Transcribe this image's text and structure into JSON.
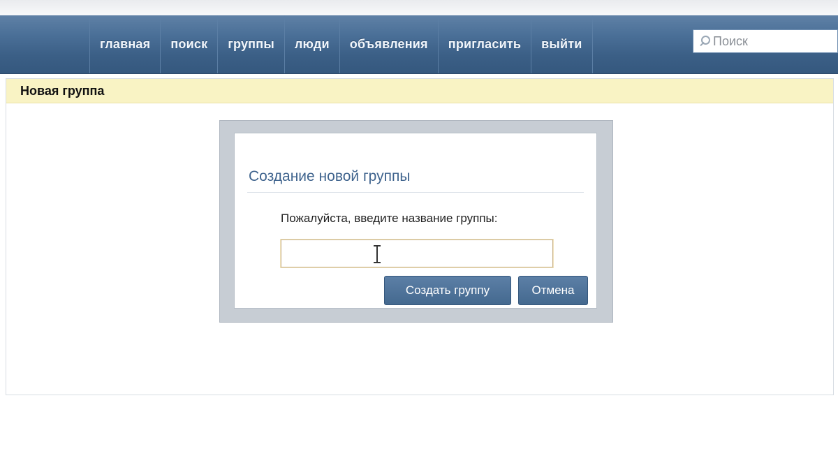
{
  "header": {
    "nav": [
      {
        "label": "главная"
      },
      {
        "label": "поиск"
      },
      {
        "label": "группы"
      },
      {
        "label": "люди"
      },
      {
        "label": "объявления"
      },
      {
        "label": "пригласить"
      },
      {
        "label": "выйти"
      }
    ],
    "search": {
      "placeholder": "Поиск",
      "value": ""
    }
  },
  "page": {
    "title": "Новая группа"
  },
  "dialog": {
    "title": "Создание новой группы",
    "prompt": "Пожалуйста, введите название группы:",
    "input_value": "",
    "create_label": "Создать группу",
    "cancel_label": "Отмена"
  },
  "colors": {
    "header_blue": "#3b5f86",
    "title_bar_yellow": "#f9f3c4",
    "dialog_title": "#40648e",
    "button_blue": "#4a6f97"
  }
}
